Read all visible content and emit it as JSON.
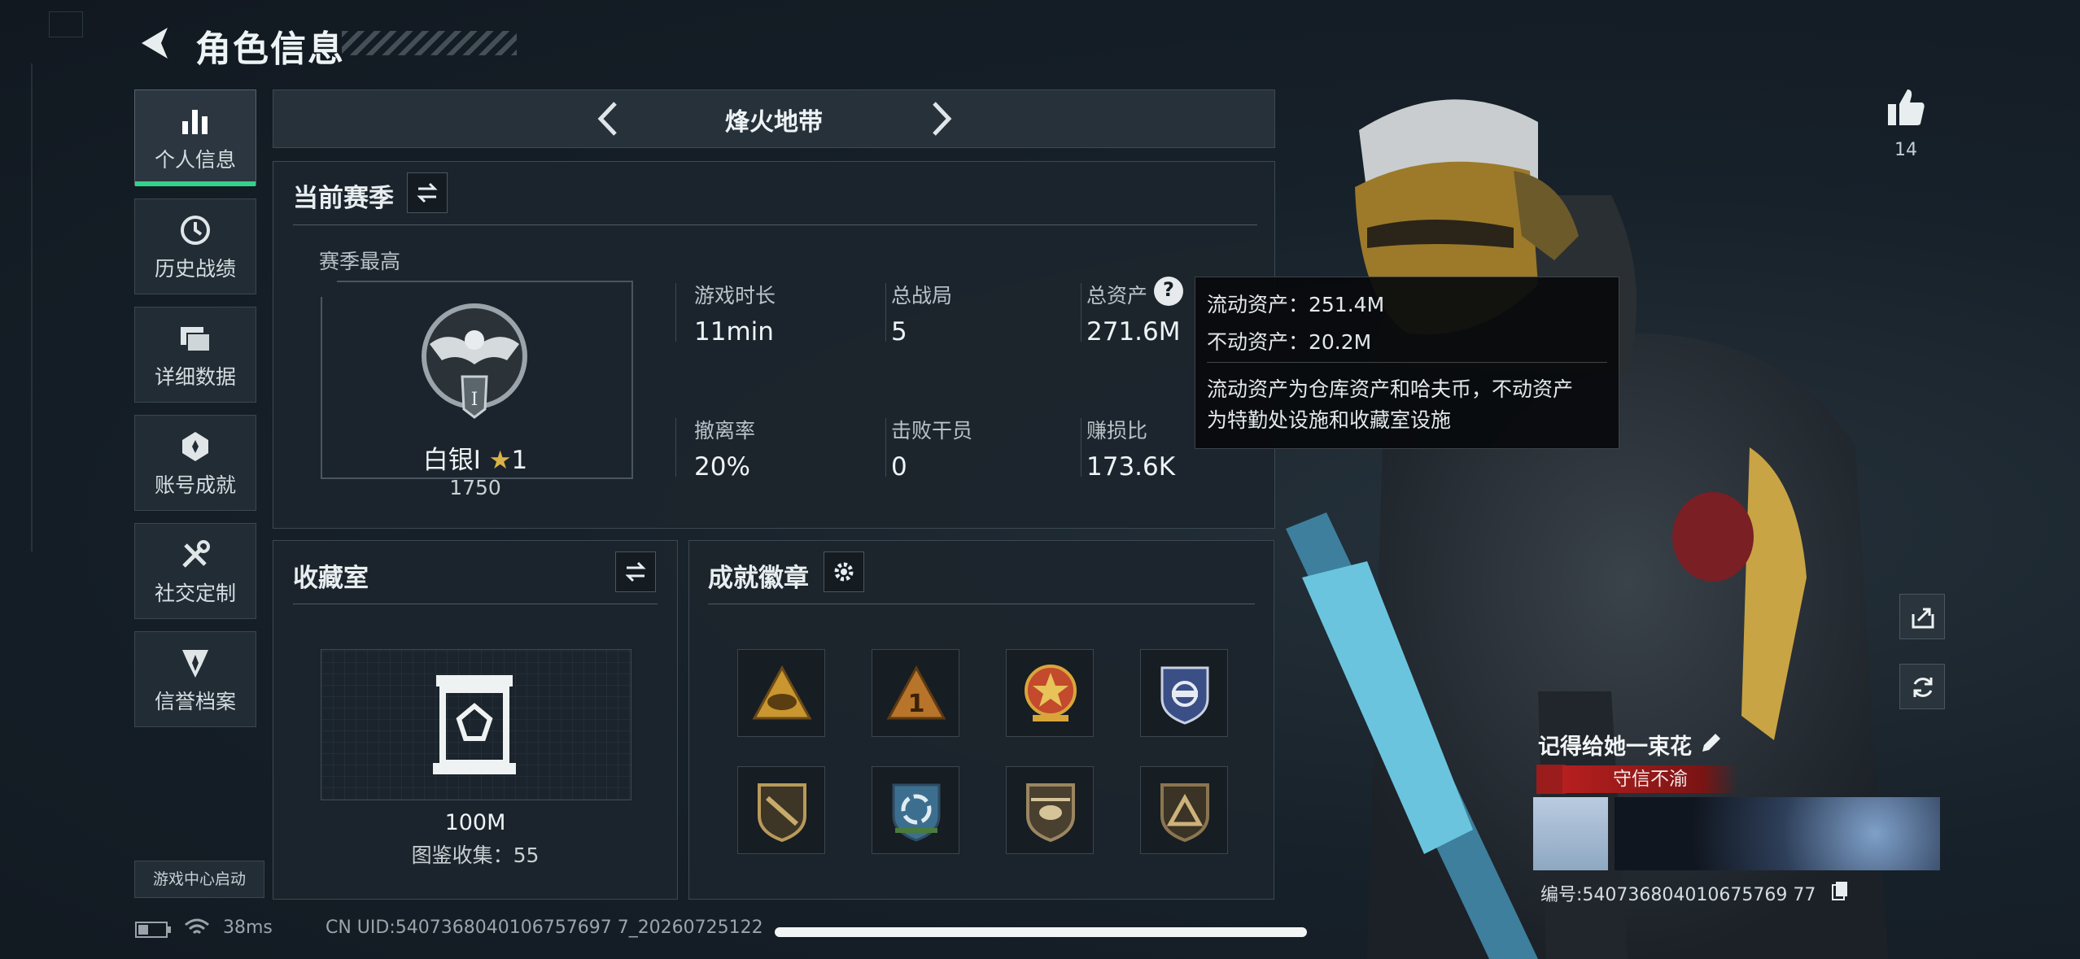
{
  "header": {
    "title": "角色信息"
  },
  "sidebar": {
    "items": [
      {
        "label": "个人信息",
        "icon": "bar-chart-icon",
        "active": true
      },
      {
        "label": "历史战绩",
        "icon": "clock-history-icon",
        "active": false
      },
      {
        "label": "详细数据",
        "icon": "folder-stack-icon",
        "active": false
      },
      {
        "label": "账号成就",
        "icon": "achievement-icon",
        "active": false
      },
      {
        "label": "社交定制",
        "icon": "tools-icon",
        "active": false
      },
      {
        "label": "信誉档案",
        "icon": "credit-shield-icon",
        "active": false
      }
    ],
    "launch_label": "游戏中心启动"
  },
  "mode_bar": {
    "mode": "烽火地带"
  },
  "season": {
    "title": "当前赛季",
    "best_label": "赛季最高",
    "rank_name": "白银I",
    "rank_star": "★",
    "rank_level": "1",
    "rank_score": "1750",
    "rank_emblem_numeral": "I",
    "stats": [
      {
        "label": "游戏时长",
        "value": "11min"
      },
      {
        "label": "总战局",
        "value": "5"
      },
      {
        "label": "总资产",
        "value": "271.6M"
      },
      {
        "label": "撤离率",
        "value": "20%"
      },
      {
        "label": "击败干员",
        "value": "0"
      },
      {
        "label": "赚损比",
        "value": "173.6K"
      }
    ]
  },
  "tooltip": {
    "line1": "流动资产：251.4M",
    "line2": "不动资产：20.2M",
    "desc1": "流动资产为仓库资产和哈夫币，不动资产",
    "desc2": "为特勤处设施和收藏室设施"
  },
  "collection": {
    "title": "收藏室",
    "value": "100M",
    "count_label": "图鉴收集：55"
  },
  "badges": {
    "title": "成就徽章",
    "items": [
      {
        "name": "badge-helmet-triangle",
        "color": "#c9962f"
      },
      {
        "name": "badge-number-one",
        "color": "#b8742a"
      },
      {
        "name": "badge-star-medal",
        "color": "#c34a2c"
      },
      {
        "name": "badge-blue-shield",
        "color": "#3a4f86"
      },
      {
        "name": "badge-rifle-shield",
        "color": "#8d7a4a"
      },
      {
        "name": "badge-cycle-emblem",
        "color": "#3c6f8f"
      },
      {
        "name": "badge-helicopter",
        "color": "#9b8660"
      },
      {
        "name": "badge-mountain-shield",
        "color": "#8a7550"
      }
    ]
  },
  "profile": {
    "likes": "14",
    "name": "记得给她一束花",
    "tag": "守信不渝",
    "uid_label": "编号:540736804010675769 77"
  },
  "status_bar": {
    "ping": "38ms",
    "uid": "CN UID:5407368040106757697 7_20260725122"
  },
  "colors": {
    "accent_green": "#35d18a",
    "tag_red": "#b71f1f"
  }
}
